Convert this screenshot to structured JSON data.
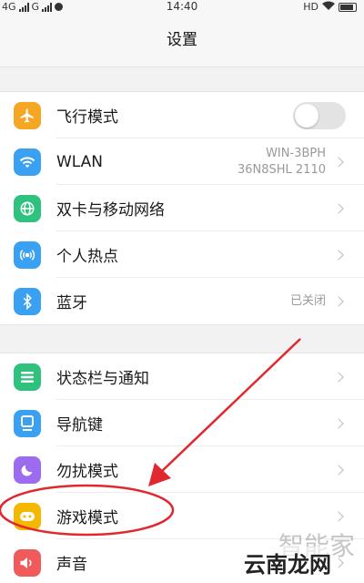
{
  "status_bar": {
    "sim1": "4G",
    "sim2": "G",
    "time": "14:40",
    "hd": "HD"
  },
  "header": {
    "title": "设置"
  },
  "group1": [
    {
      "label": "飞行模式",
      "icon": "airplane-icon",
      "color": "#f5a623"
    },
    {
      "label": "WLAN",
      "icon": "wifi-icon",
      "color": "#3aa0f2",
      "value_line1": "WIN-3BPH",
      "value_line2": "36N8SHL 2110"
    },
    {
      "label": "双卡与移动网络",
      "icon": "globe-icon",
      "color": "#2ec27e"
    },
    {
      "label": "个人热点",
      "icon": "hotspot-icon",
      "color": "#3aa0f2"
    },
    {
      "label": "蓝牙",
      "icon": "bluetooth-icon",
      "color": "#3aa0f2",
      "value": "已关闭"
    }
  ],
  "group2": [
    {
      "label": "状态栏与通知",
      "icon": "notification-icon",
      "color": "#2ec27e"
    },
    {
      "label": "导航键",
      "icon": "navigation-icon",
      "color": "#3aa0f2"
    },
    {
      "label": "勿扰模式",
      "icon": "moon-icon",
      "color": "#9b6cf0"
    },
    {
      "label": "游戏模式",
      "icon": "gamepad-icon",
      "color": "#f5b800"
    },
    {
      "label": "声音",
      "icon": "speaker-icon",
      "color": "#f05a5a"
    }
  ],
  "airplane_mode_on": false,
  "watermark": {
    "line1": "智能家",
    "line2": "云南龙网"
  }
}
